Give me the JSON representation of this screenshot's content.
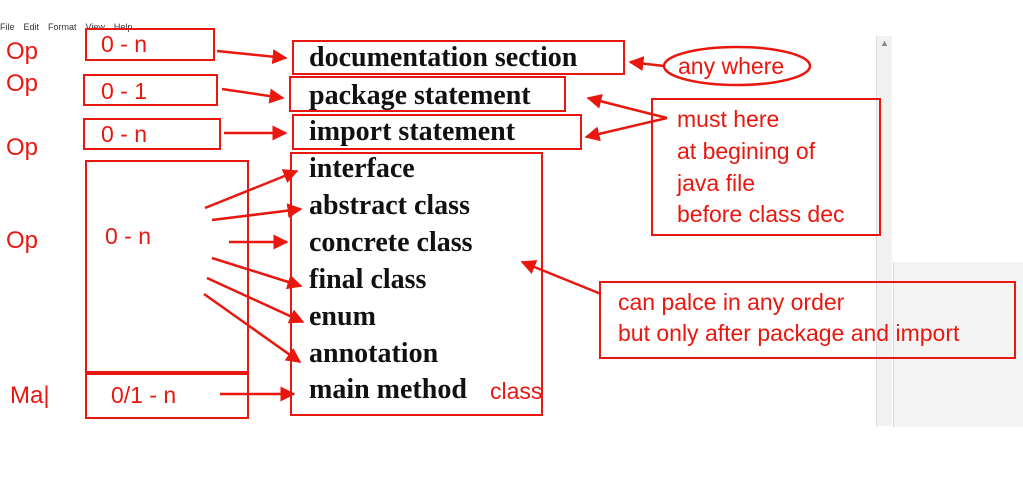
{
  "menu": [
    "File",
    "Edit",
    "Format",
    "View",
    "Help"
  ],
  "left_labels": [
    "Op",
    "Op",
    "Op",
    "Op",
    "Ma|"
  ],
  "counts": [
    "0 - n",
    "0 - 1",
    "0 - n",
    "0 - n",
    "0/1 - n"
  ],
  "statements": [
    "documentation section",
    "package statement",
    "import statement",
    "interface",
    "abstract class",
    "concrete class",
    "final class",
    "enum",
    "annotation",
    "main method"
  ],
  "main_suffix": "class",
  "any_where": "any where",
  "must_note": [
    "must here",
    "at begining of",
    "java file",
    "before class dec"
  ],
  "order_note": [
    "can palce in any order",
    "but only after package and import"
  ],
  "colors": {
    "annotation": "#e8170f",
    "text": "#111111"
  }
}
